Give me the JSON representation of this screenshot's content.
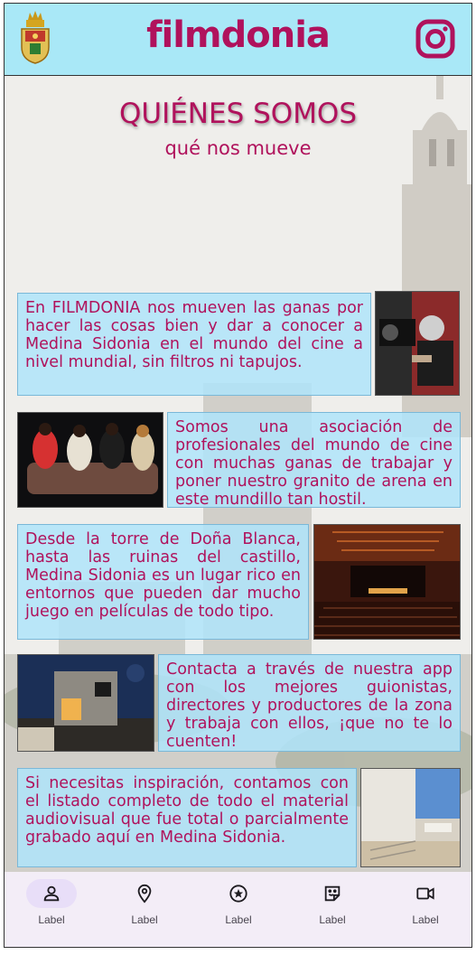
{
  "header": {
    "brand": "filmdonia",
    "crest_icon": "crest-icon",
    "social_icon": "instagram-icon",
    "brand_color": "#b0125c",
    "bar_color": "#a9e8f7"
  },
  "hero": {
    "title": "QUIÉNES SOMOS",
    "subtitle": "qué nos mueve"
  },
  "cards": [
    {
      "text": "En FILMDONIA nos mueven las ganas por hacer las cosas bien y dar a conocer a Medina Sidonia en el mundo del cine a nivel mundial, sin filtros ni tapujos.",
      "image": "director-camera-photo"
    },
    {
      "text": "Somos una asociación de profesionales del mundo de cine con muchas ganas de trabajar y poner nuestro granito de arena en este mundillo tan hostil.",
      "image": "actresses-sofa-photo"
    },
    {
      "text": "Desde la torre de Doña Blanca, hasta las ruinas del castillo, Medina Sidonia es un lugar rico en entornos que pueden dar mucho juego en películas de todo tipo.",
      "image": "theater-auditorium-photo"
    },
    {
      "text": "Contacta a través de nuestra app con los mejores guionistas, directores y productores de la zona y trabaja con ellos, ¡que no te lo cuenten!",
      "image": "modern-building-night-photo"
    },
    {
      "text": "Si necesitas inspiración, contamos con el listado completo de todo el material audiovisual que fue total o parcialmente grabado aquí en Medina Sidonia.",
      "image": "white-courtyard-photo"
    }
  ],
  "nav": [
    {
      "label": "Label",
      "icon": "person-icon",
      "active": true
    },
    {
      "label": "Label",
      "icon": "location-pin-icon",
      "active": false
    },
    {
      "label": "Label",
      "icon": "star-circle-icon",
      "active": false
    },
    {
      "label": "Label",
      "icon": "sticker-icon",
      "active": false
    },
    {
      "label": "Label",
      "icon": "video-camera-icon",
      "active": false
    }
  ]
}
